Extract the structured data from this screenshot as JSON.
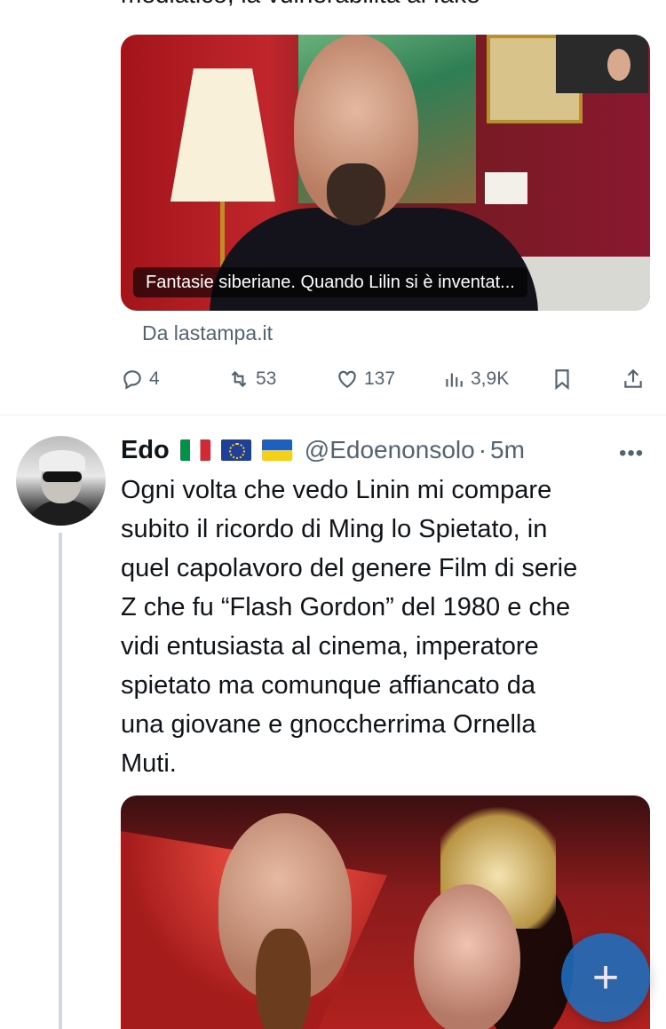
{
  "prev_tweet": {
    "cut_text": "mediatico, la vulnerabilità al fake",
    "link_card": {
      "caption": "Fantasie siberiane. Quando Lilin si è inventat...",
      "source": "Da lastampa.it"
    },
    "actions": {
      "replies": "4",
      "retweets": "53",
      "likes": "137",
      "views": "3,9K"
    }
  },
  "tweet": {
    "name": "Edo",
    "flags": [
      "🇮🇹",
      "🇪🇺",
      "🇺🇦"
    ],
    "handle": "@Edoenonsolo",
    "separator": "·",
    "time": "5m",
    "more": "•••",
    "text": "Ogni volta che vedo Linin mi compare\nsubito il ricordo di Ming lo Spietato, in\nquel capolavoro del genere Film di serie\nZ che fu “Flash Gordon” del 1980 e che\nvidi entusiasta al cinema, imperatore\nspietato ma comunque affiancato da\nuna giovane e gnoccherrima Ornella\nMuti."
  },
  "fab": {
    "label": "+"
  },
  "colors": {
    "text": "#0f1419",
    "secondary": "#536471",
    "fab": "#1d6fbf",
    "divider": "#eff3f4"
  }
}
